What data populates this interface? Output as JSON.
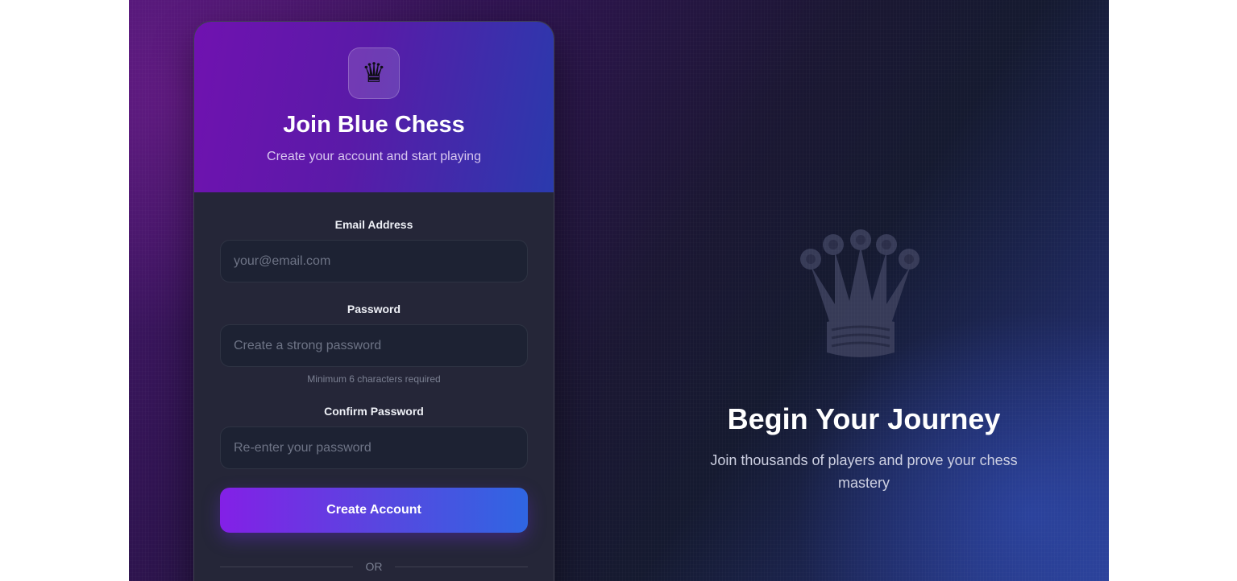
{
  "card": {
    "logo_icon": "♛",
    "title": "Join Blue Chess",
    "subtitle": "Create your account and start playing"
  },
  "form": {
    "email": {
      "label": "Email Address",
      "placeholder": "your@email.com",
      "value": ""
    },
    "password": {
      "label": "Password",
      "placeholder": "Create a strong password",
      "value": "",
      "hint": "Minimum 6 characters required"
    },
    "confirm": {
      "label": "Confirm Password",
      "placeholder": "Re-enter your password",
      "value": ""
    },
    "submit_label": "Create Account",
    "divider_text": "OR"
  },
  "hero": {
    "icon": "queen-icon",
    "title": "Begin Your Journey",
    "subtitle": "Join thousands of players and prove your chess mastery"
  },
  "colors": {
    "accent_start": "#8320e6",
    "accent_end": "#2f66e2",
    "card_bg": "#252638",
    "input_bg": "#1d2233"
  }
}
